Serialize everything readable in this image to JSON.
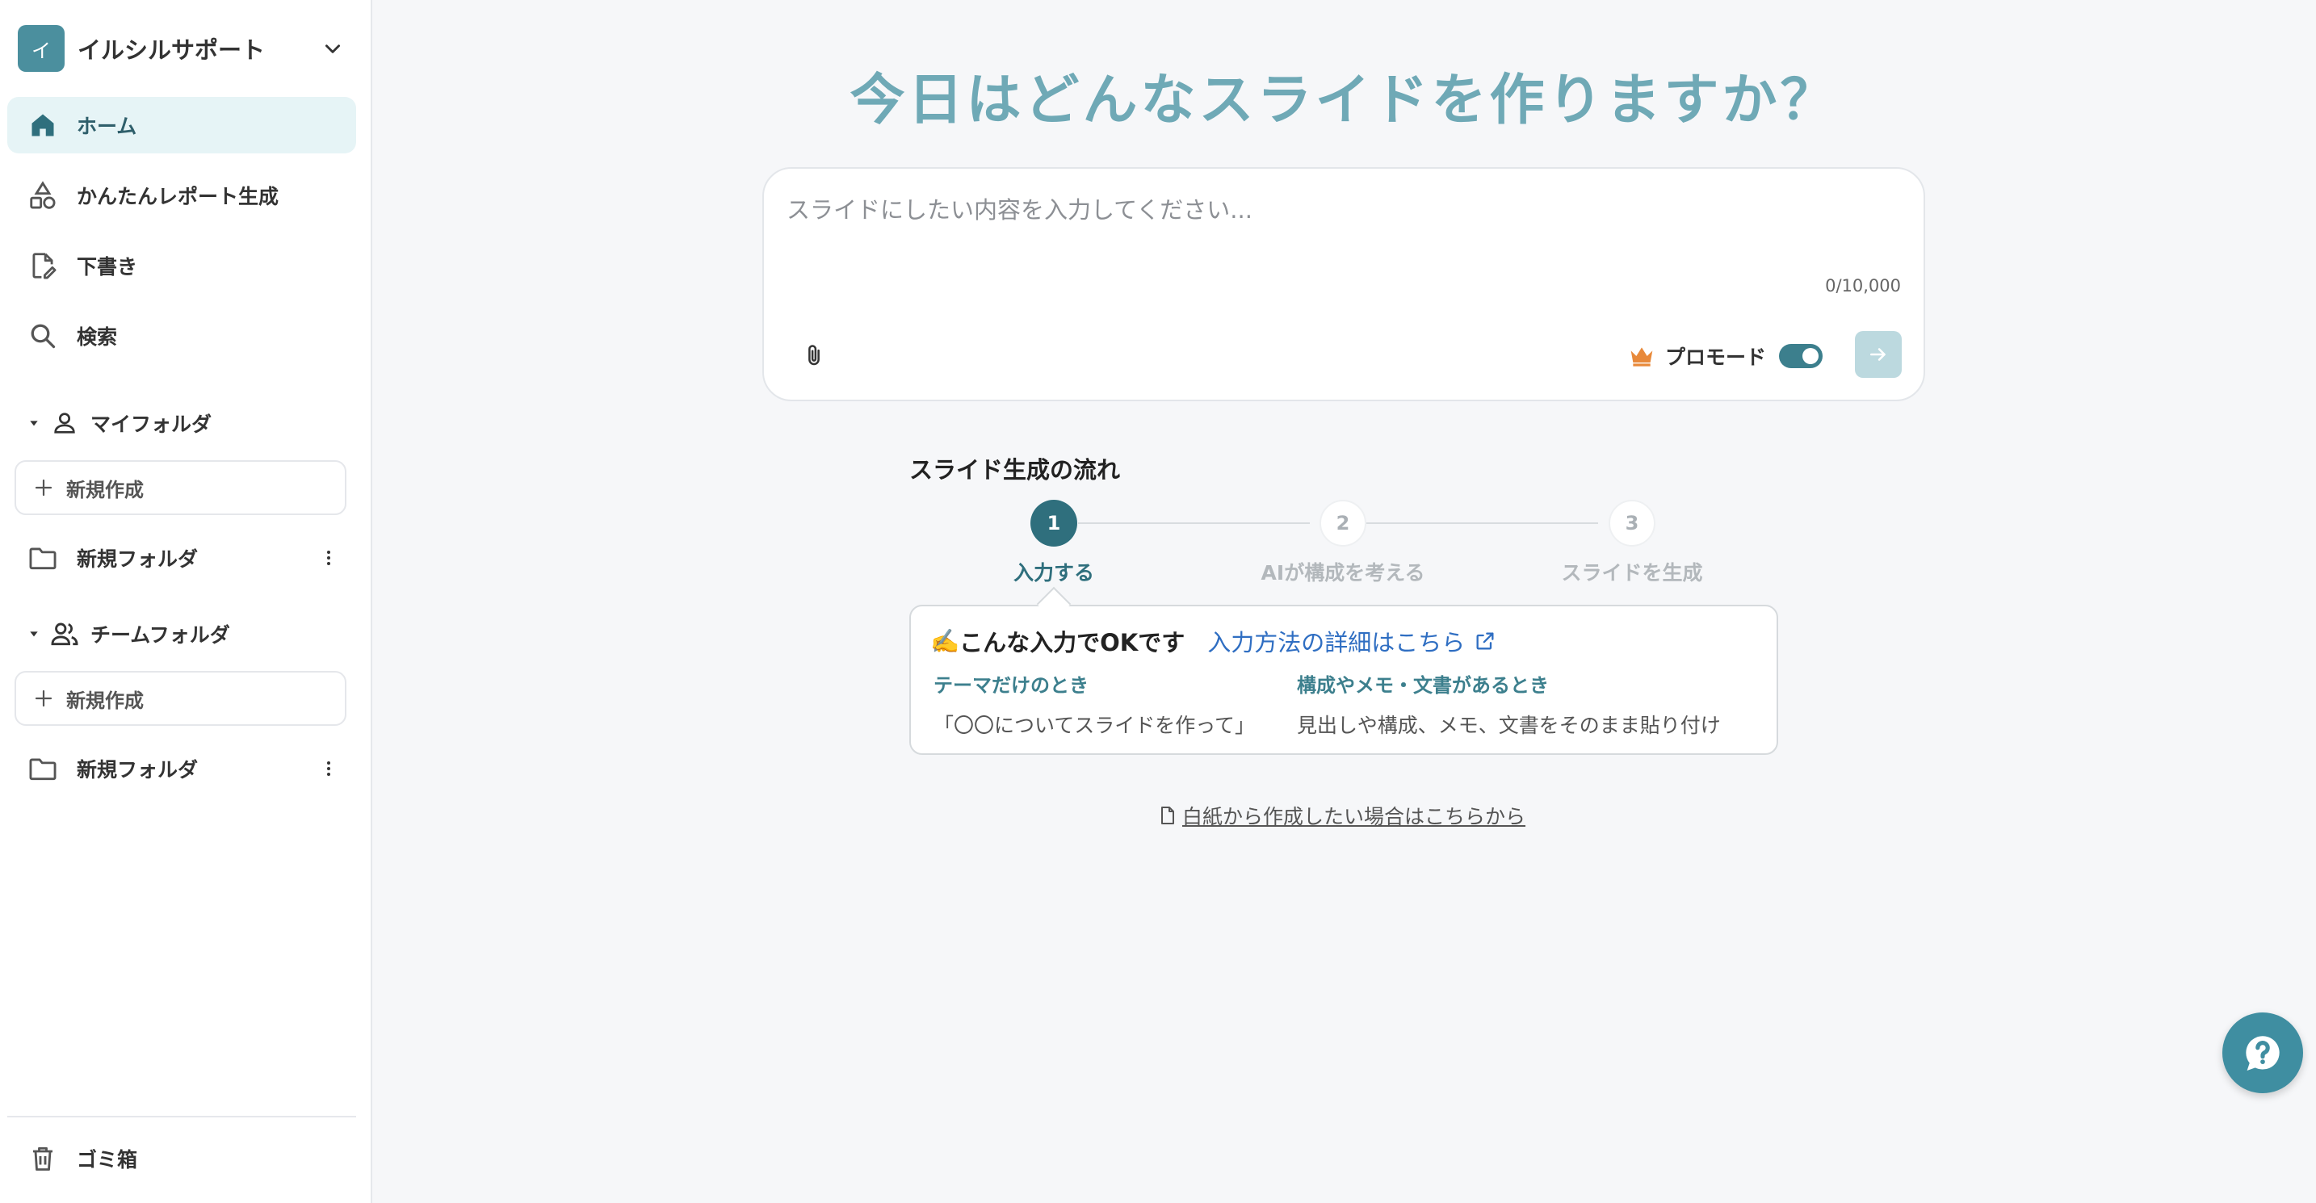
{
  "workspace": {
    "avatar_letter": "イ",
    "name": "イルシルサポート"
  },
  "nav": {
    "home": "ホーム",
    "report": "かんたんレポート生成",
    "drafts": "下書き",
    "search": "検索"
  },
  "my_folder": {
    "title": "マイフォルダ",
    "new_label": "新規作成",
    "folders": [
      "新規フォルダ"
    ]
  },
  "team_folder": {
    "title": "チームフォルダ",
    "new_label": "新規作成",
    "folders": [
      "新規フォルダ"
    ]
  },
  "trash": "ゴミ箱",
  "main": {
    "headline": "今日はどんなスライドを作りますか？",
    "input": {
      "placeholder": "スライドにしたい内容を入力してください...",
      "value": "",
      "counter": "0/10,000"
    },
    "pro_mode": {
      "label": "プロモード",
      "enabled": true
    },
    "flow": {
      "title": "スライド生成の流れ",
      "steps": [
        {
          "number": "1",
          "label": "入力する",
          "active": true
        },
        {
          "number": "2",
          "label": "AIが構成を考える",
          "active": false
        },
        {
          "number": "3",
          "label": "スライドを生成",
          "active": false
        }
      ]
    },
    "tip": {
      "emoji": "✍️",
      "title": "こんな入力でOKです",
      "link": "入力方法の詳細はこちら",
      "col1_head": "テーマだけのとき",
      "col1_body": "「〇〇についてスライドを作って」",
      "col2_head": "構成やメモ・文書があるとき",
      "col2_body": "見出しや構成、メモ、文書をそのまま貼り付け"
    },
    "blank_link": "白紙から作成したい場合はこちらから"
  },
  "colors": {
    "accent": "#3c7f8d",
    "headline": "#6fa9b6",
    "active_nav_bg": "#e6f4f6",
    "link": "#2f6ec2",
    "crown": "#e8893a"
  }
}
